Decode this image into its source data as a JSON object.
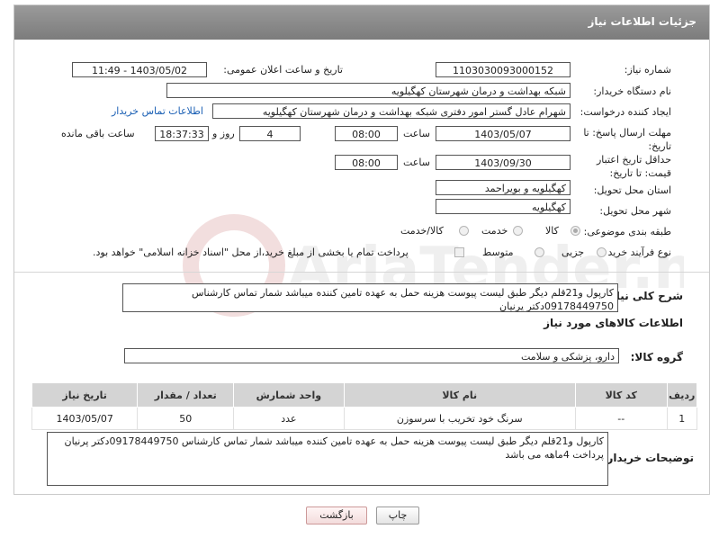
{
  "title": "جزئیات اطلاعات نیاز",
  "watermark_text": "AriaTender.net",
  "fields": {
    "need_number_label": "شماره نیاز:",
    "need_number": "1103030093000152",
    "announce_label": "تاریخ و ساعت اعلان عمومی:",
    "announce_value": "1403/05/02 - 11:49",
    "buyer_org_label": "نام دستگاه خریدار:",
    "buyer_org": "شبکه بهداشت و درمان شهرستان کهگیلویه",
    "creator_label": "ایجاد کننده درخواست:",
    "creator": "شهرام عادل گستر امور دفتری شبکه بهداشت و درمان شهرستان کهگیلویه",
    "contact_link": "اطلاعات تماس خریدار",
    "deadline_label": "مهلت ارسال پاسخ: تا تاریخ:",
    "deadline_date": "1403/05/07",
    "time_label": "ساعت",
    "deadline_time": "08:00",
    "days_value": "4",
    "days_label": "روز و",
    "remaining_time": "18:37:33",
    "remaining_label": "ساعت باقی مانده",
    "validity_label": "حداقل تاریخ اعتبار قیمت: تا تاریخ:",
    "validity_date": "1403/09/30",
    "validity_time": "08:00",
    "province_label": "استان محل تحویل:",
    "province": "کهگیلویه و بویراحمد",
    "city_label": "شهر محل تحویل:",
    "city": "کهگیلویه",
    "category_label": "طبقه بندی موضوعی:",
    "category_options": [
      "کالا",
      "خدمت",
      "کالا/خدمت"
    ],
    "process_label": "نوع فرآیند خرید :",
    "process_options": [
      "جزیی",
      "متوسط"
    ],
    "payment_note": "پرداخت تمام یا بخشی از مبلغ خرید،از محل \"اسناد خزانه اسلامی\" خواهد بود."
  },
  "summary": {
    "label": "شرح کلی نیاز:",
    "text": "کارپول و21قلم دیگر طبق لیست پیوست هزینه حمل به عهده تامین کننده میباشد شمار تماس کارشناس 09178449750دکتر پرنیان"
  },
  "goods": {
    "section_title": "اطلاعات کالاهای مورد نیاز",
    "group_label": "گروه کالا:",
    "group_value": "دارو، پزشکی و سلامت",
    "columns": [
      "ردیف",
      "کد کالا",
      "نام کالا",
      "واحد شمارش",
      "تعداد / مقدار",
      "تاریخ نیاز"
    ],
    "rows": [
      {
        "row": "1",
        "code": "--",
        "name": "سرنگ خود تخریب با سرسوزن",
        "unit": "عدد",
        "qty": "50",
        "date": "1403/05/07"
      }
    ]
  },
  "buyer_notes": {
    "label": "توضیحات خریدار:",
    "text": "کارپول و21قلم دیگر طبق لیست پیوست هزینه حمل به عهده تامین کننده میباشد شمار تماس کارشناس 09178449750دکتر پرنیان پرداخت 4ماهه می باشد"
  },
  "buttons": {
    "print": "چاپ",
    "back": "بازگشت"
  }
}
